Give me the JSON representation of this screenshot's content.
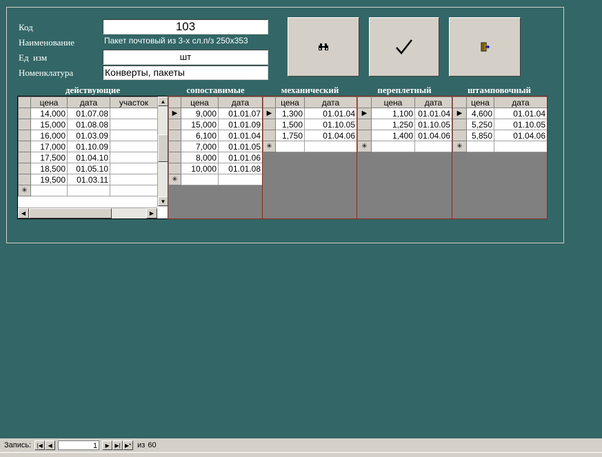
{
  "form": {
    "labels": {
      "code": "Код",
      "name": "Наименование",
      "unit": "Ед  изм",
      "nomenclature": "Номенклатура"
    },
    "code_value": "103",
    "name_value": "Пакет почтовый из 3-х сл.п/з 250х353",
    "unit_value": "шт",
    "nomenclature_value": "Конверты, пакеты"
  },
  "buttons": {
    "find_icon": "binoculars-icon",
    "confirm_icon": "checkmark-icon",
    "exit_icon": "exit-door-icon"
  },
  "grids": {
    "active": {
      "title": "действующие",
      "columns": [
        "цена",
        "дата",
        "участок"
      ],
      "rows": [
        [
          "14,000",
          "01.07.08",
          ""
        ],
        [
          "15,000",
          "01.08.08",
          ""
        ],
        [
          "16,000",
          "01.03.09",
          ""
        ],
        [
          "17,000",
          "01.10.09",
          ""
        ],
        [
          "17,500",
          "01.04.10",
          ""
        ],
        [
          "18,500",
          "01.05.10",
          ""
        ],
        [
          "19,500",
          "01.03.11",
          ""
        ]
      ]
    },
    "comparable": {
      "title": "сопоставимые",
      "columns": [
        "цена",
        "дата"
      ],
      "rows": [
        [
          "9,000",
          "01.01.07"
        ],
        [
          "15,000",
          "01.01.09"
        ],
        [
          "6,100",
          "01.01.04"
        ],
        [
          "7,000",
          "01.01.05"
        ],
        [
          "8,000",
          "01.01.06"
        ],
        [
          "10,000",
          "01.01.08"
        ]
      ]
    },
    "mechanical": {
      "title": "механический",
      "columns": [
        "цена",
        "дата"
      ],
      "rows": [
        [
          "1,300",
          "01.01.04"
        ],
        [
          "1,500",
          "01.10.05"
        ],
        [
          "1,750",
          "01.04.06"
        ]
      ]
    },
    "binding": {
      "title": "переплетный",
      "columns": [
        "цена",
        "дата"
      ],
      "rows": [
        [
          "1,100",
          "01.01.04"
        ],
        [
          "1,250",
          "01.10.05"
        ],
        [
          "1,400",
          "01.04.06"
        ]
      ]
    },
    "stamping": {
      "title": "штамповочный",
      "columns": [
        "цена",
        "дата"
      ],
      "rows": [
        [
          "4,600",
          "01.01.04"
        ],
        [
          "5,250",
          "01.10.05"
        ],
        [
          "5,850",
          "01.04.06"
        ]
      ]
    }
  },
  "statusbar": {
    "record_label": "Запись:",
    "current": "1",
    "of_label": "из",
    "total": "60"
  }
}
